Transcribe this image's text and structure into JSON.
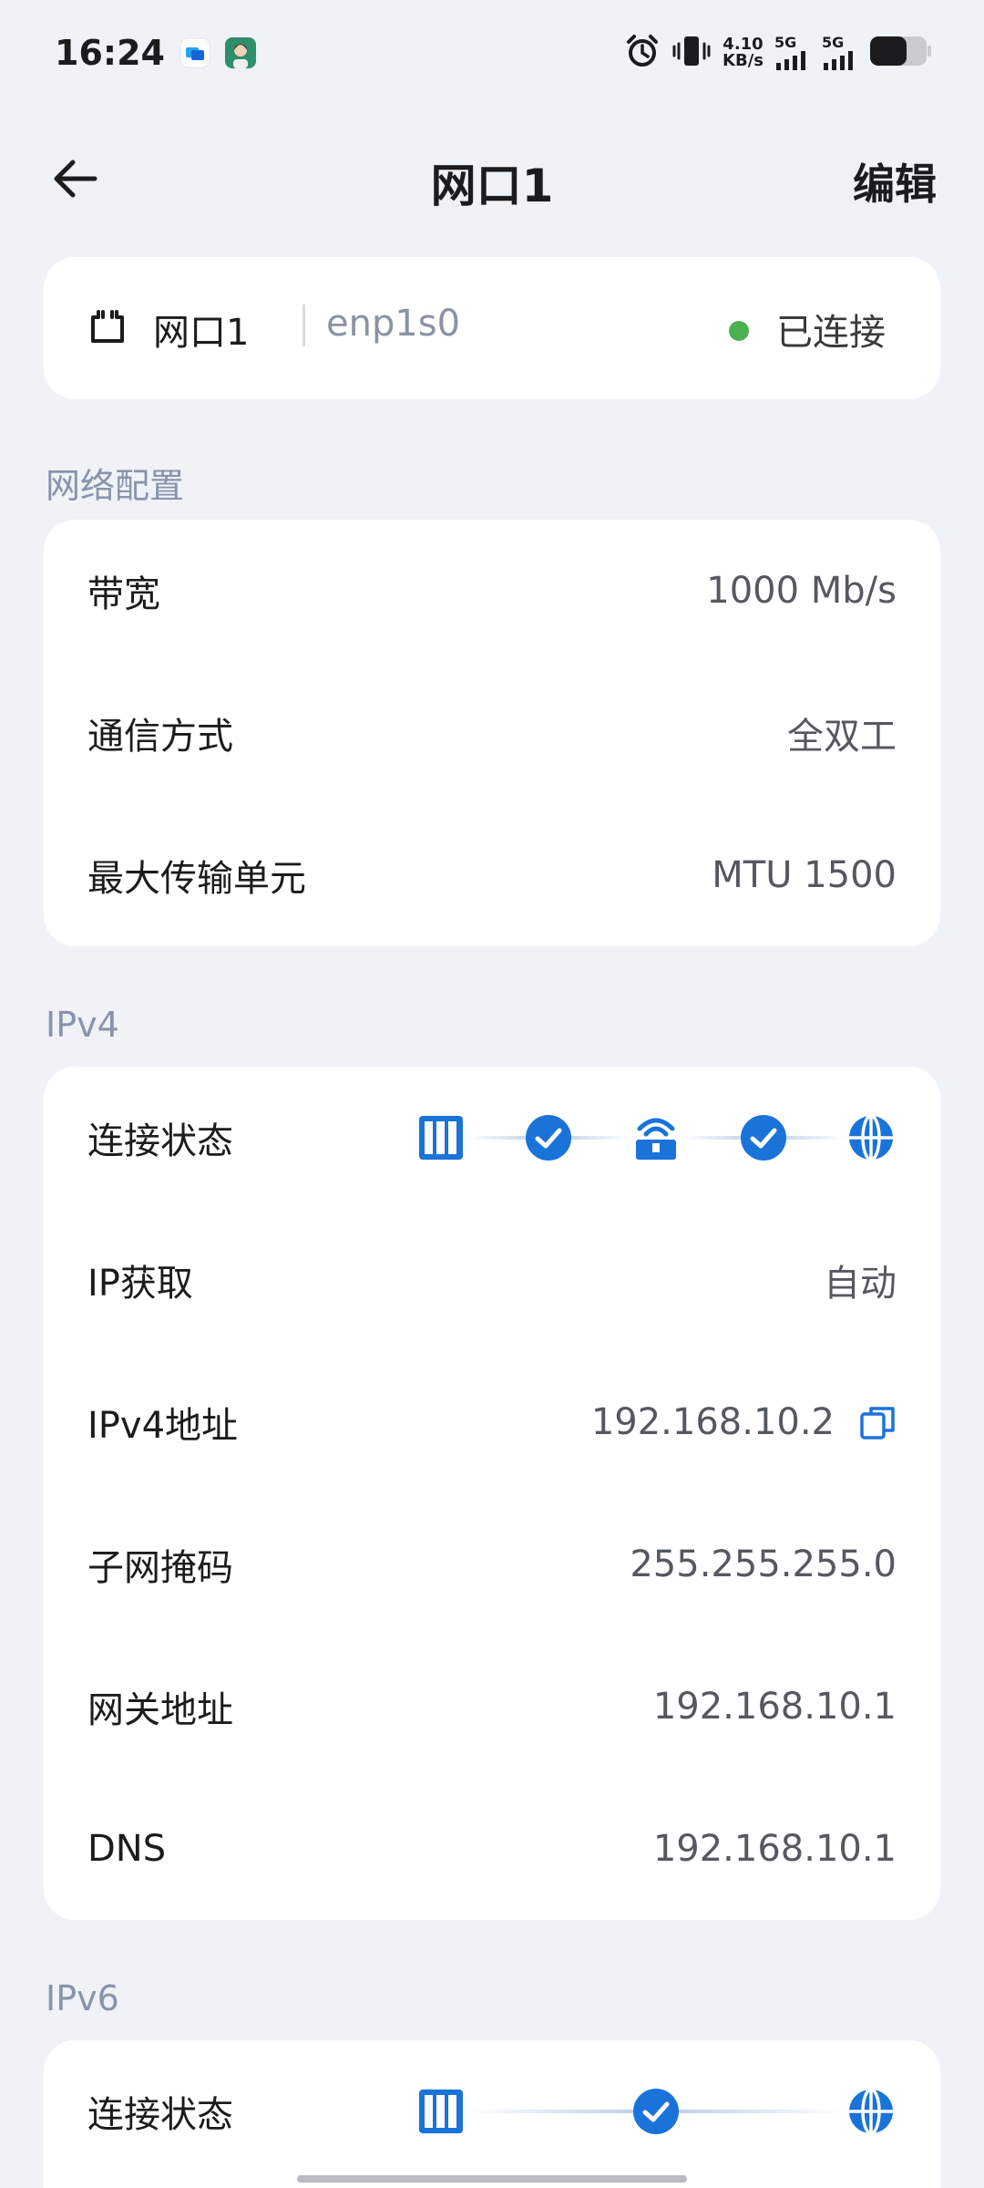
{
  "status_bar": {
    "time": "16:24",
    "net_speed_value": "4.10",
    "net_speed_unit": "KB/s",
    "sim1_label": "5G",
    "sim2_label": "5G",
    "icons": [
      "app-icon-blue",
      "avatar-icon",
      "alarm-icon",
      "vibrate-icon",
      "signal-icon",
      "battery-icon"
    ]
  },
  "header": {
    "title": "网口1",
    "edit_label": "编辑",
    "back_icon": "arrow-left-icon"
  },
  "port": {
    "name": "网口1",
    "interface": "enp1s0",
    "status": "已连接",
    "status_color": "#4caf50",
    "icon": "ethernet-port-icon"
  },
  "network_config": {
    "title": "网络配置",
    "rows": [
      {
        "label": "带宽",
        "value": "1000 Mb/s"
      },
      {
        "label": "通信方式",
        "value": "全双工"
      },
      {
        "label": "最大传输单元",
        "value": "MTU 1500"
      }
    ]
  },
  "ipv4": {
    "title": "IPv4",
    "connection_label": "连接状态",
    "flow_nodes": [
      "device-icon",
      "check-icon",
      "router-icon",
      "check-icon",
      "globe-icon"
    ],
    "rows": [
      {
        "label": "IP获取",
        "value": "自动"
      },
      {
        "label": "IPv4地址",
        "value": "192.168.10.2"
      },
      {
        "label": "子网掩码",
        "value": "255.255.255.0"
      },
      {
        "label": "网关地址",
        "value": "192.168.10.1"
      },
      {
        "label": "DNS",
        "value": "192.168.10.1"
      }
    ]
  },
  "ipv6": {
    "title": "IPv6",
    "connection_label": "连接状态",
    "flow_nodes": [
      "device-icon",
      "check-icon",
      "globe-icon"
    ]
  },
  "colors": {
    "accent": "#1a73d9",
    "background": "#eff2f7",
    "card": "#ffffff",
    "section_title": "#8894aa"
  }
}
